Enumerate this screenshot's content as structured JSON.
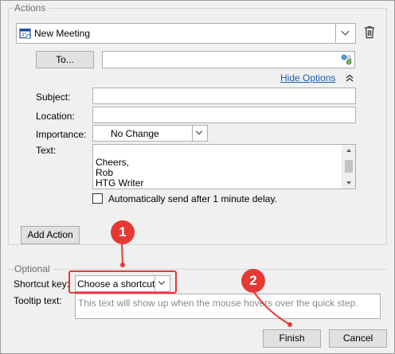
{
  "actions_group": {
    "label": "Actions"
  },
  "action_select": {
    "value": "New Meeting"
  },
  "to_button": {
    "label": "To..."
  },
  "to_field": {
    "value": ""
  },
  "hide_options": {
    "label": "Hide Options"
  },
  "fields": {
    "subject_label": "Subject:",
    "subject_value": "",
    "location_label": "Location:",
    "location_value": "",
    "importance_label": "Importance:",
    "importance_value": "No Change",
    "text_label": "Text:",
    "text_lines": [
      "Cheers,",
      "Rob",
      "HTG Writer"
    ]
  },
  "auto_send": {
    "label": "Automatically send after 1 minute delay.",
    "checked": false
  },
  "add_action": {
    "label": "Add Action"
  },
  "optional_group": {
    "label": "Optional"
  },
  "shortcut": {
    "label": "Shortcut key:",
    "value": "Choose a shortcut"
  },
  "tooltip": {
    "label": "Tooltip text:",
    "placeholder": "This text will show up when the mouse hovers over the quick step."
  },
  "finish": {
    "label": "Finish"
  },
  "cancel": {
    "label": "Cancel"
  },
  "annotations": {
    "badge1": "1",
    "badge2": "2",
    "color": "#e53935"
  },
  "icons": [
    "meeting-icon",
    "trash-icon",
    "address-book-icon",
    "chevron-up-icon",
    "chevron-down-icon"
  ]
}
